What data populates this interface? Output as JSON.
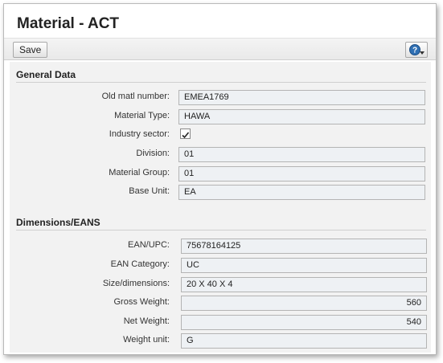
{
  "window": {
    "title": "Material - ACT"
  },
  "toolbar": {
    "save_label": "Save",
    "help_icon": "help-icon"
  },
  "general": {
    "title": "General Data",
    "old_matl_label": "Old matl number:",
    "old_matl_value": "EMEA1769",
    "material_type_label": "Material Type:",
    "material_type_value": "HAWA",
    "industry_label": "Industry sector:",
    "industry_checked": true,
    "division_label": "Division:",
    "division_value": "01",
    "material_group_label": "Material Group:",
    "material_group_value": "01",
    "base_unit_label": "Base Unit:",
    "base_unit_value": "EA"
  },
  "dimensions": {
    "title": "Dimensions/EANS",
    "ean_label": "EAN/UPC:",
    "ean_value": "75678164125",
    "ean_category_label": "EAN Category:",
    "ean_category_value": "UC",
    "size_label": "Size/dimensions:",
    "size_value": "20 X 40 X 4",
    "gross_weight_label": "Gross Weight:",
    "gross_weight_value": "560",
    "net_weight_label": "Net Weight:",
    "net_weight_value": "540",
    "weight_unit_label": "Weight unit:",
    "weight_unit_value": "G"
  }
}
